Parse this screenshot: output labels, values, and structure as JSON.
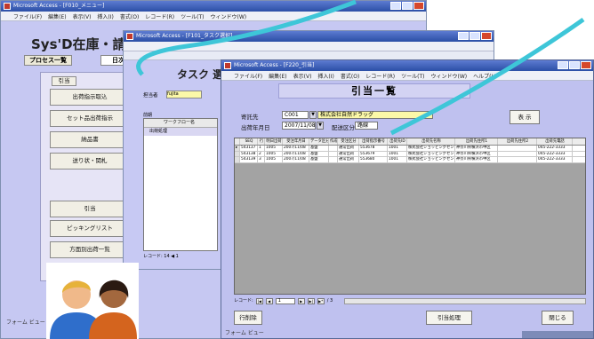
{
  "win1": {
    "title": "Microsoft Access - [F010_メニュー]",
    "menu": [
      "ファイル(F)",
      "編集(E)",
      "表示(V)",
      "挿入(I)",
      "書式(O)",
      "レコード(R)",
      "ツール(T)",
      "ウィンドウ(W)"
    ],
    "app_title": "Sys'D在庫・請求シ",
    "tabs": [
      "プロセス一覧",
      "日次"
    ],
    "buttons": [
      "出荷指示取込",
      "セット品出荷指示",
      "納品書",
      "送り状・関札",
      "引当",
      "ピッキングリスト",
      "方面別出荷一覧"
    ],
    "small_button": "引当",
    "status": "フォーム ビュー"
  },
  "win2": {
    "title": "Microsoft Access - [F101_タスク選択]",
    "heading": "タスク 選",
    "label": "担当者",
    "input_value": "fujita",
    "list_label": "前期",
    "list_header": "ワークフロー名",
    "list_item": "出荷処理",
    "record_nav": "レコード: 14 ◀ 1"
  },
  "win3": {
    "title": "Microsoft Access - [F220_引当]",
    "menu": [
      "ファイル(F)",
      "編集(E)",
      "表示(V)",
      "挿入(I)",
      "書式(O)",
      "レコード(R)",
      "ツール(T)",
      "ウィンドウ(W)",
      "ヘルプ(H)"
    ],
    "form_title": "引当一覧",
    "consignor_label": "寄託先",
    "consignor_code": "C001",
    "consignor_name": "株式会社自然ドラッグ",
    "ship_date_label": "出荷年月日",
    "ship_date": "2007/11/08",
    "delivery_label": "配送区分",
    "delivery_value": "路線",
    "show_button": "表 示",
    "columns": [
      "SEQ",
      "行",
      "明日出荷",
      "受注年月日",
      "データ区分",
      "作成",
      "受注区分",
      "出荷指示番号",
      "出荷先ID",
      "出荷先名称",
      "出荷先住所1",
      "出荷先住所2",
      "出荷先電話"
    ],
    "rows": [
      [
        "543137",
        "1",
        "1005",
        "2007/11/08",
        "基盤",
        "",
        "通常出荷",
        "553678",
        "1001",
        "株式会社ショッピングセンター",
        "神奈川県横浜市中区",
        "",
        "045-222-3333"
      ],
      [
        "543138",
        "2",
        "1005",
        "2007/11/08",
        "基盤",
        "",
        "通常出荷",
        "553679",
        "1001",
        "株式会社ショッピングセンター",
        "神奈川県横浜市中区",
        "",
        "045-222-3333"
      ],
      [
        "543139",
        "3",
        "1005",
        "2007/11/08",
        "基盤",
        "",
        "通常出荷",
        "553680",
        "1001",
        "株式会社ショッピングセンター",
        "神奈川県横浜市中区",
        "",
        "045-222-3333"
      ]
    ],
    "record_label": "レコード:",
    "record_current": "1",
    "record_total": "/ 3",
    "btn_delete": "行削除",
    "btn_allocate": "引当処理",
    "btn_close": "閉じる",
    "status": "フォーム ビュー"
  },
  "colors": {
    "form_bg": "#bfc1ef",
    "title_bar": "#2b4fa6",
    "highlight_yellow": "#fbf8a8",
    "arrow": "#3ec6d8"
  },
  "icons": {
    "people": "two-users-icon",
    "arrow": "flow-arrow"
  }
}
